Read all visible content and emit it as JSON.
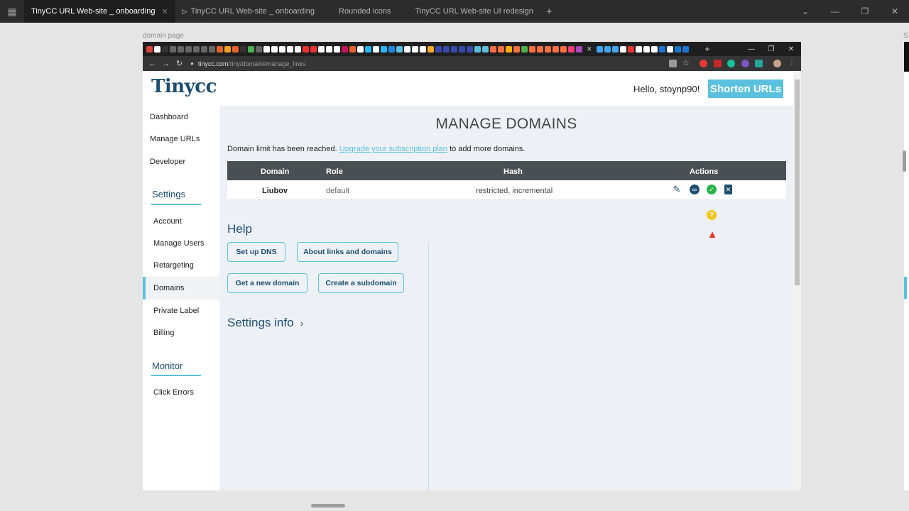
{
  "figma": {
    "tabs": [
      {
        "label": "TinyCC URL Web-site _ onboarding"
      },
      {
        "label": "TinyCC URL Web-site _ onboarding"
      },
      {
        "label": "Rounded icons"
      },
      {
        "label": "TinyCC URL Web-site UI redesign"
      }
    ],
    "frame_label": "domain page",
    "frame_label_2": "S"
  },
  "browser": {
    "url_host": "tinycc.com",
    "url_path": "/tiny/domain#manage_links"
  },
  "page": {
    "logo": "Tinycc",
    "greeting": "Hello, stoynp90!",
    "shorten_label": "Shorten URLs",
    "sidebar": {
      "dashboard": "Dashboard",
      "manage_urls": "Manage URLs",
      "developer": "Developer",
      "settings_heading": "Settings",
      "account": "Account",
      "manage_users": "Manage Users",
      "retargeting": "Retargeting",
      "domains": "Domains",
      "private_label": "Private Label",
      "billing": "Billing",
      "monitor_heading": "Monitor",
      "click_errors": "Click Errors"
    },
    "title": "MANAGE DOMAINS",
    "limit": {
      "before": "Domain limit has been reached. ",
      "link": "Upgrade your subscription plan",
      "after": " to add more domains."
    },
    "table": {
      "headers": {
        "domain": "Domain",
        "role": "Role",
        "hash": "Hash",
        "actions": "Actions"
      },
      "rows": [
        {
          "domain": "Liubov",
          "role": "default",
          "hash": "restricted, incremental"
        }
      ]
    },
    "help": {
      "heading": "Help",
      "setup_dns": "Set up DNS",
      "about_links": "About links and domains",
      "get_domain": "Get a new domain",
      "create_subdomain": "Create a subdomain"
    },
    "settings_info": "Settings info",
    "icons": {
      "edit": "pencil-icon",
      "link": "link-icon",
      "check": "check-circle-icon",
      "delete": "trash-icon",
      "question": "question-circle-icon",
      "warning": "warning-triangle-icon"
    },
    "colors": {
      "accent": "#5bc0de",
      "brand": "#1f4e6e",
      "table_header": "#4a4f53",
      "check": "#2ab34a",
      "question": "#f5c518",
      "warning": "#e53935"
    }
  }
}
